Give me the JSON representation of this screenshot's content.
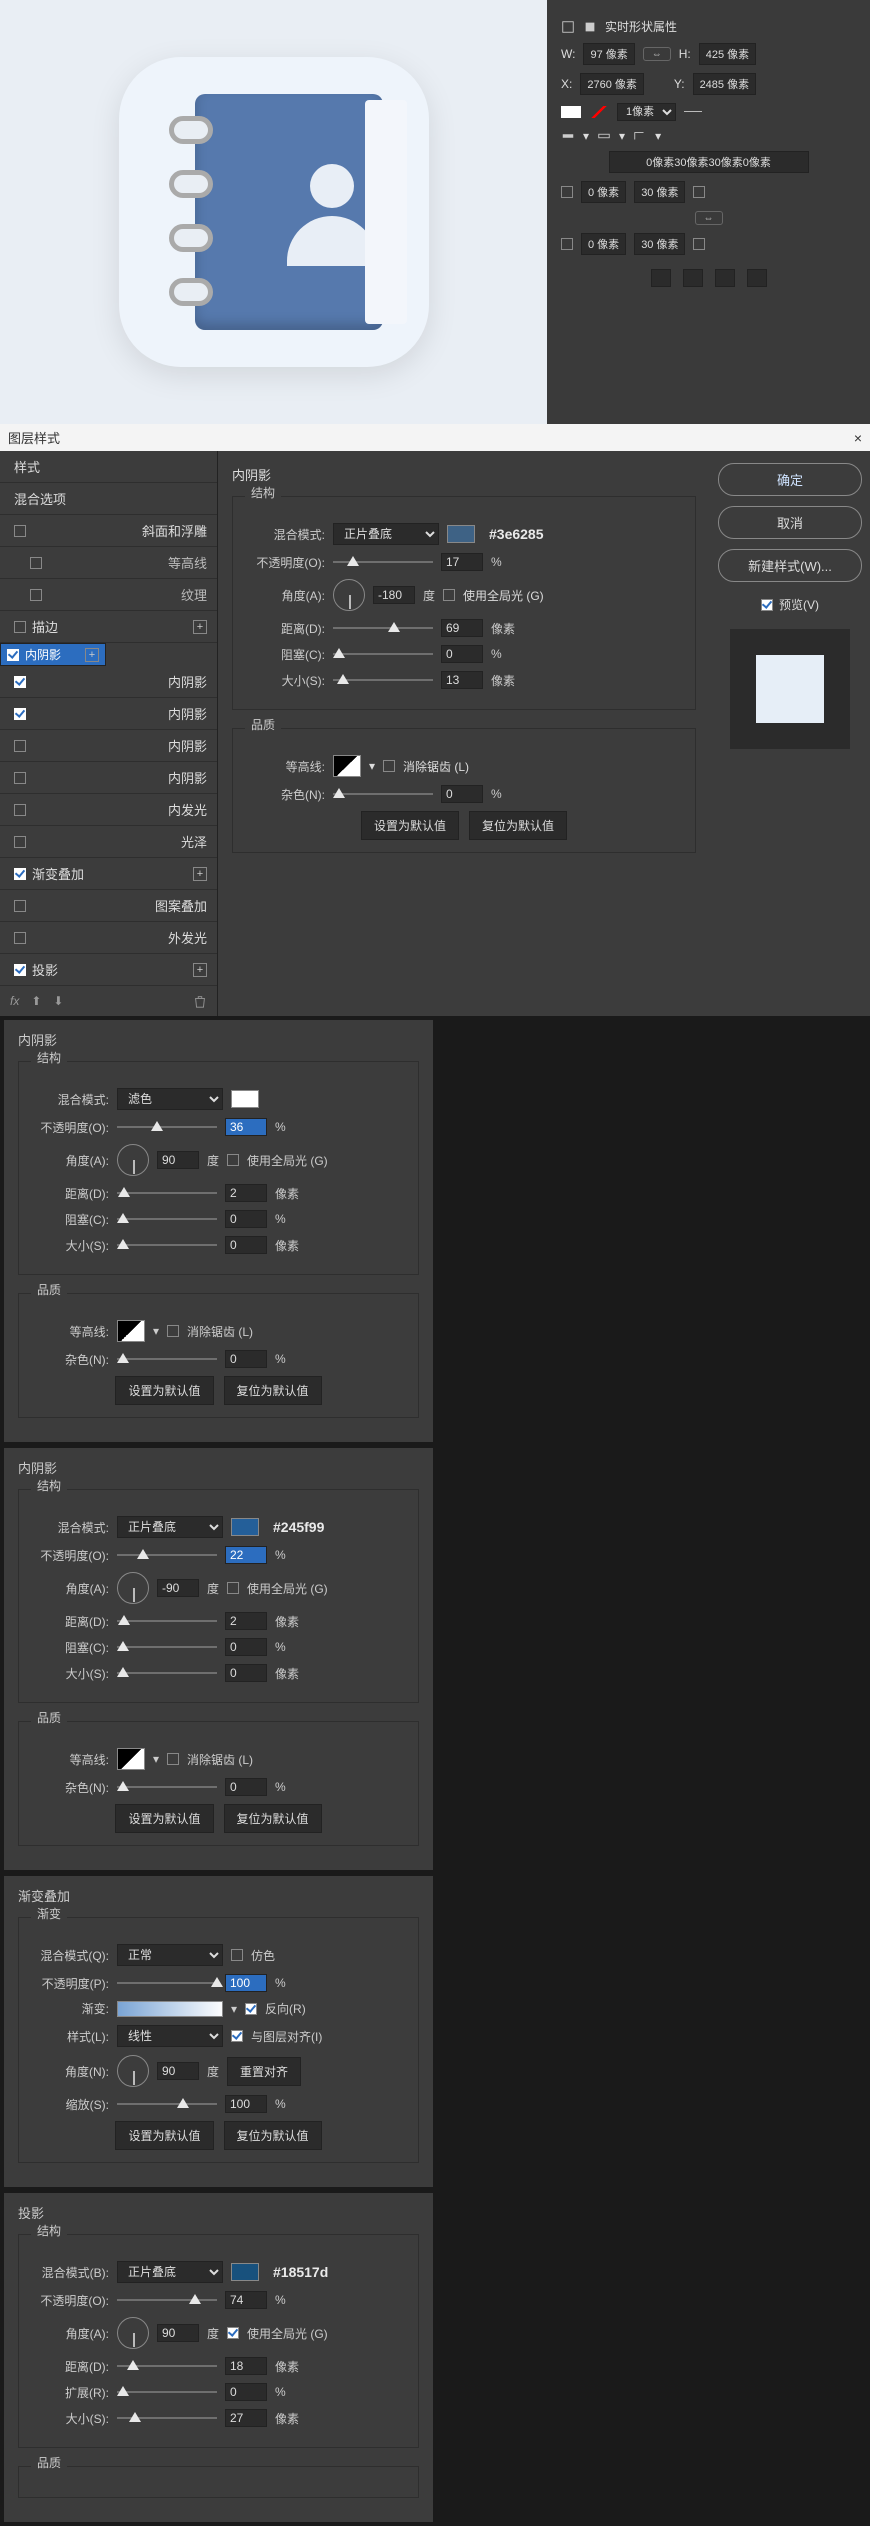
{
  "shape_panel": {
    "title": "实时形状属性",
    "w_label": "W:",
    "w_value": "97 像素",
    "h_label": "H:",
    "h_value": "425 像素",
    "x_label": "X:",
    "x_value": "2760 像素",
    "y_label": "Y:",
    "y_value": "2485 像素",
    "link": "⇔",
    "stroke_width": "1像素",
    "corner_header": "0像素30像素30像素0像素",
    "c0": "0 像素",
    "c1": "30 像素",
    "c2": "30 像素",
    "c3": "0 像素"
  },
  "dialog": {
    "title": "图层样式",
    "close": "×",
    "btn_ok": "确定",
    "btn_cancel": "取消",
    "btn_newstyle": "新建样式(W)...",
    "preview_label": "预览(V)",
    "left": {
      "styles": "样式",
      "blend_options": "混合选项",
      "bevel": "斜面和浮雕",
      "contour": "等高线",
      "texture": "纹理",
      "stroke": "描边",
      "inner_shadow": "内阴影",
      "inner_glow": "内发光",
      "satin": "光泽",
      "grad_overlay": "渐变叠加",
      "pattern_overlay": "图案叠加",
      "outer_glow": "外发光",
      "drop_shadow": "投影",
      "fx": "fx"
    }
  },
  "center": {
    "title": "内阴影",
    "grp_struct": "结构",
    "grp_quality": "品质",
    "blend_label": "混合模式:",
    "blend_val": "正片叠底",
    "hex": "#3e6285",
    "opacity_label": "不透明度(O):",
    "opacity_val": "17",
    "angle_label": "角度(A):",
    "angle_val": "-180",
    "angle_unit": "度",
    "global_light": "使用全局光 (G)",
    "distance_label": "距离(D):",
    "distance_val": "69",
    "px_unit": "像素",
    "choke_label": "阻塞(C):",
    "choke_val": "0",
    "size_label": "大小(S):",
    "size_val": "13",
    "contour_label": "等高线:",
    "antialias": "消除锯齿 (L)",
    "noise_label": "杂色(N):",
    "noise_val": "0",
    "btn_default": "设置为默认值",
    "btn_reset": "复位为默认值",
    "pct": "%"
  },
  "p2": {
    "title": "内阴影",
    "grp_struct": "结构",
    "grp_quality": "品质",
    "blend_label": "混合模式:",
    "blend_val": "滤色",
    "opacity_val": "36",
    "angle_val": "90",
    "distance_val": "2",
    "choke_val": "0",
    "size_val": "0",
    "noise_val": "0"
  },
  "p3": {
    "title": "内阴影",
    "grp_struct": "结构",
    "grp_quality": "品质",
    "blend_val": "正片叠底",
    "hex": "#245f99",
    "opacity_val": "22",
    "angle_val": "-90",
    "distance_val": "2",
    "choke_val": "0",
    "size_val": "0",
    "noise_val": "0"
  },
  "p4": {
    "title": "渐变叠加",
    "grp": "渐变",
    "blend_label": "混合模式(Q):",
    "blend_val": "正常",
    "dither": "仿色",
    "opacity_label": "不透明度(P):",
    "opacity_val": "100",
    "grad_label": "渐变:",
    "style_label": "样式(L):",
    "style_val": "线性",
    "align": "与图层对齐(I)",
    "reverse": "反向(R)",
    "angle_label": "角度(N):",
    "angle_val": "90",
    "reset_align": "重置对齐",
    "scale_label": "缩放(S):",
    "scale_val": "100"
  },
  "p5": {
    "title": "投影",
    "grp_struct": "结构",
    "grp_quality": "品质",
    "blend_label": "混合模式(B):",
    "blend_val": "正片叠底",
    "hex": "#18517d",
    "opacity_label": "不透明度(O):",
    "opacity_val": "74",
    "angle_label": "角度(A):",
    "angle_val": "90",
    "global_light": "使用全局光 (G)",
    "distance_label": "距离(D):",
    "distance_val": "18",
    "spread_label": "扩展(R):",
    "spread_val": "0",
    "size_label": "大小(S):",
    "size_val": "27"
  },
  "chart_data": null
}
